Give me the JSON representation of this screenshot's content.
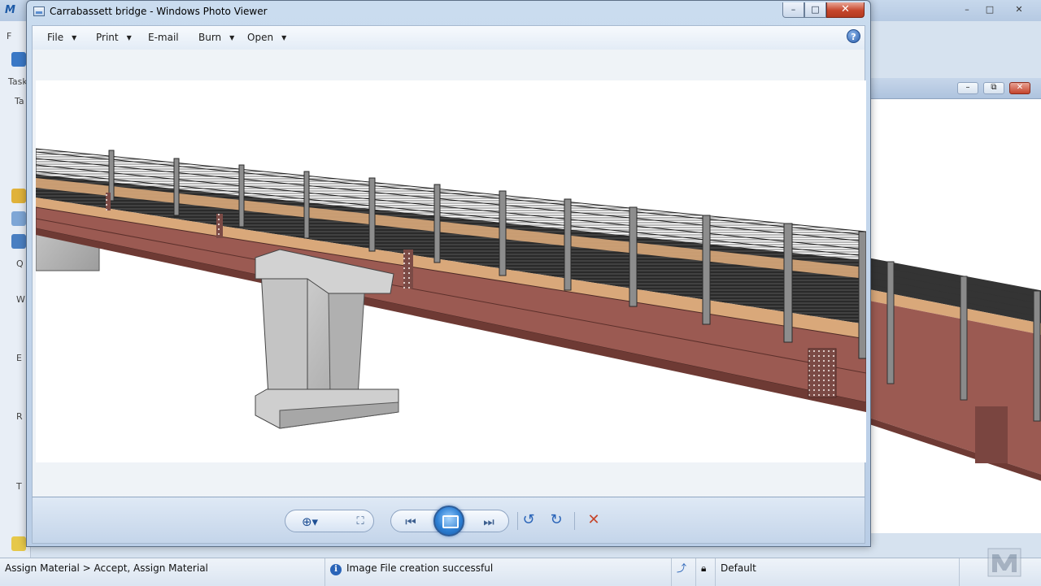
{
  "background_app": {
    "left_labels": [
      "F",
      "Task",
      "Ta",
      "Q",
      "W",
      "E",
      "R",
      "T"
    ],
    "window_controls": [
      "–",
      "□",
      "✕"
    ],
    "view_controls": [
      "–",
      "⧉",
      "✕"
    ]
  },
  "photo_viewer": {
    "title": "Carrabassett bridge - Windows Photo Viewer",
    "window_controls": {
      "minimize": "–",
      "maximize": "□",
      "close": "✕"
    },
    "menu": {
      "file": "File",
      "print": "Print",
      "email": "E-mail",
      "burn": "Burn",
      "open": "Open",
      "help": "?"
    },
    "image_subject": "Carrabassett bridge"
  },
  "status_bar": {
    "command": "Assign Material > Accept, Assign Material",
    "message": "Image File creation successful",
    "level": "Default"
  },
  "colors": {
    "girder": "#9b5a52",
    "deck_wood": "#d9a87a",
    "concrete": "#b9b9b9",
    "accent_blue": "#2d7fd4",
    "close_red": "#c6462c"
  }
}
